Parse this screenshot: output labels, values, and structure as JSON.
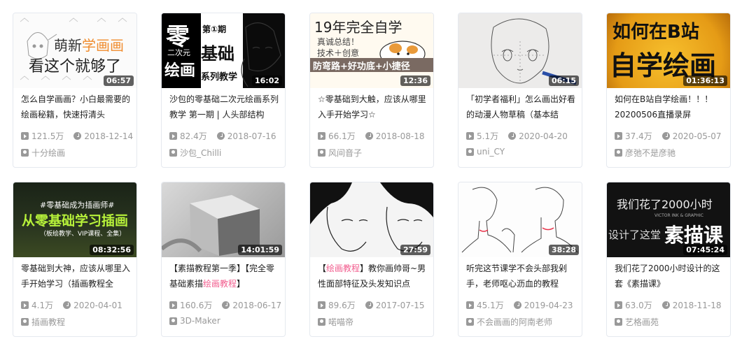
{
  "cards": [
    {
      "thumb": {
        "line1_a": "萌新",
        "line1_b": "学画画",
        "line2": "看这个就够了"
      },
      "duration": "06:57",
      "title": "怎么自学画画？小白最需要的绘画秘籍，快速捋清头",
      "views": "121.5万",
      "date": "2018-12-14",
      "author": "十分绘画"
    },
    {
      "thumb": {
        "big1": "零",
        "small1": "二次元",
        "big2": "绘画",
        "issue": "第①期",
        "label": "基础",
        "sub": "系列教学"
      },
      "duration": "16:02",
      "title": "沙包的零基础二次元绘画系列教学 第一期 | 人头部结构",
      "views": "82.4万",
      "date": "2018-07-16",
      "author": "沙包_Chilli"
    },
    {
      "thumb": {
        "head": "19年完全自学",
        "l1": "真诚总结！",
        "l2": "技术＋创意",
        "banner": "防弯路+好功底+小捷径"
      },
      "duration": "12:36",
      "title": "☆零基础到大触，应该从哪里入手开始学习☆",
      "views": "66.1万",
      "date": "2018-08-18",
      "author": "风间音子"
    },
    {
      "thumb": {},
      "duration": "06:15",
      "title": "「初学者福利」怎么画出好看的动漫人物草稿（基本结",
      "views": "5.1万",
      "date": "2020-04-20",
      "author": "uni_CY"
    },
    {
      "thumb": {
        "l1": "如何在B站",
        "l2": "自学绘画"
      },
      "duration": "01:36:13",
      "title": "如何在B站自学绘画！！！20200506直播录屏",
      "views": "37.4万",
      "date": "2020-05-07",
      "author": "彦弛不是彦驰"
    },
    {
      "thumb": {
        "tag": "#零基础成为插画师#",
        "main": "从零基础学习插画",
        "sub": "（板绘教学、VIP课程、全集）"
      },
      "duration": "08:32:56",
      "title": "零基础到大神，应该从哪里入手开始学习（插画教程全",
      "views": "4.1万",
      "date": "2020-04-01",
      "author": "插画教程"
    },
    {
      "thumb": {},
      "duration": "14:01:59",
      "title_parts": [
        "【素描教程第一季】【完全零基础素描",
        "绘画教程",
        "】"
      ],
      "views": "160.6万",
      "date": "2018-06-17",
      "author": "3D-Maker"
    },
    {
      "thumb": {},
      "duration": "27:59",
      "title_parts": [
        "【",
        "绘画教程",
        "】教你画帅哥~男性面部特征及头发知识点"
      ],
      "views": "89.6万",
      "date": "2017-07-15",
      "author": "喏喵帝"
    },
    {
      "thumb": {},
      "duration": "38:28",
      "title": "听完这节课学不会头部我剁手，老师呕心沥血的教程",
      "views": "45.1万",
      "date": "2019-04-23",
      "author": "不会画画的阿南老师"
    },
    {
      "thumb": {
        "l1": "我们花了2000小时",
        "l2": "VICTOR INK & GRAPHIC",
        "l3": "设计了这堂",
        "big": "素描课"
      },
      "duration": "07:45:24",
      "title": "我们花了2000小时设计的这套《素描课》",
      "views": "63.0万",
      "date": "2018-11-18",
      "author": "艺格画苑"
    }
  ]
}
